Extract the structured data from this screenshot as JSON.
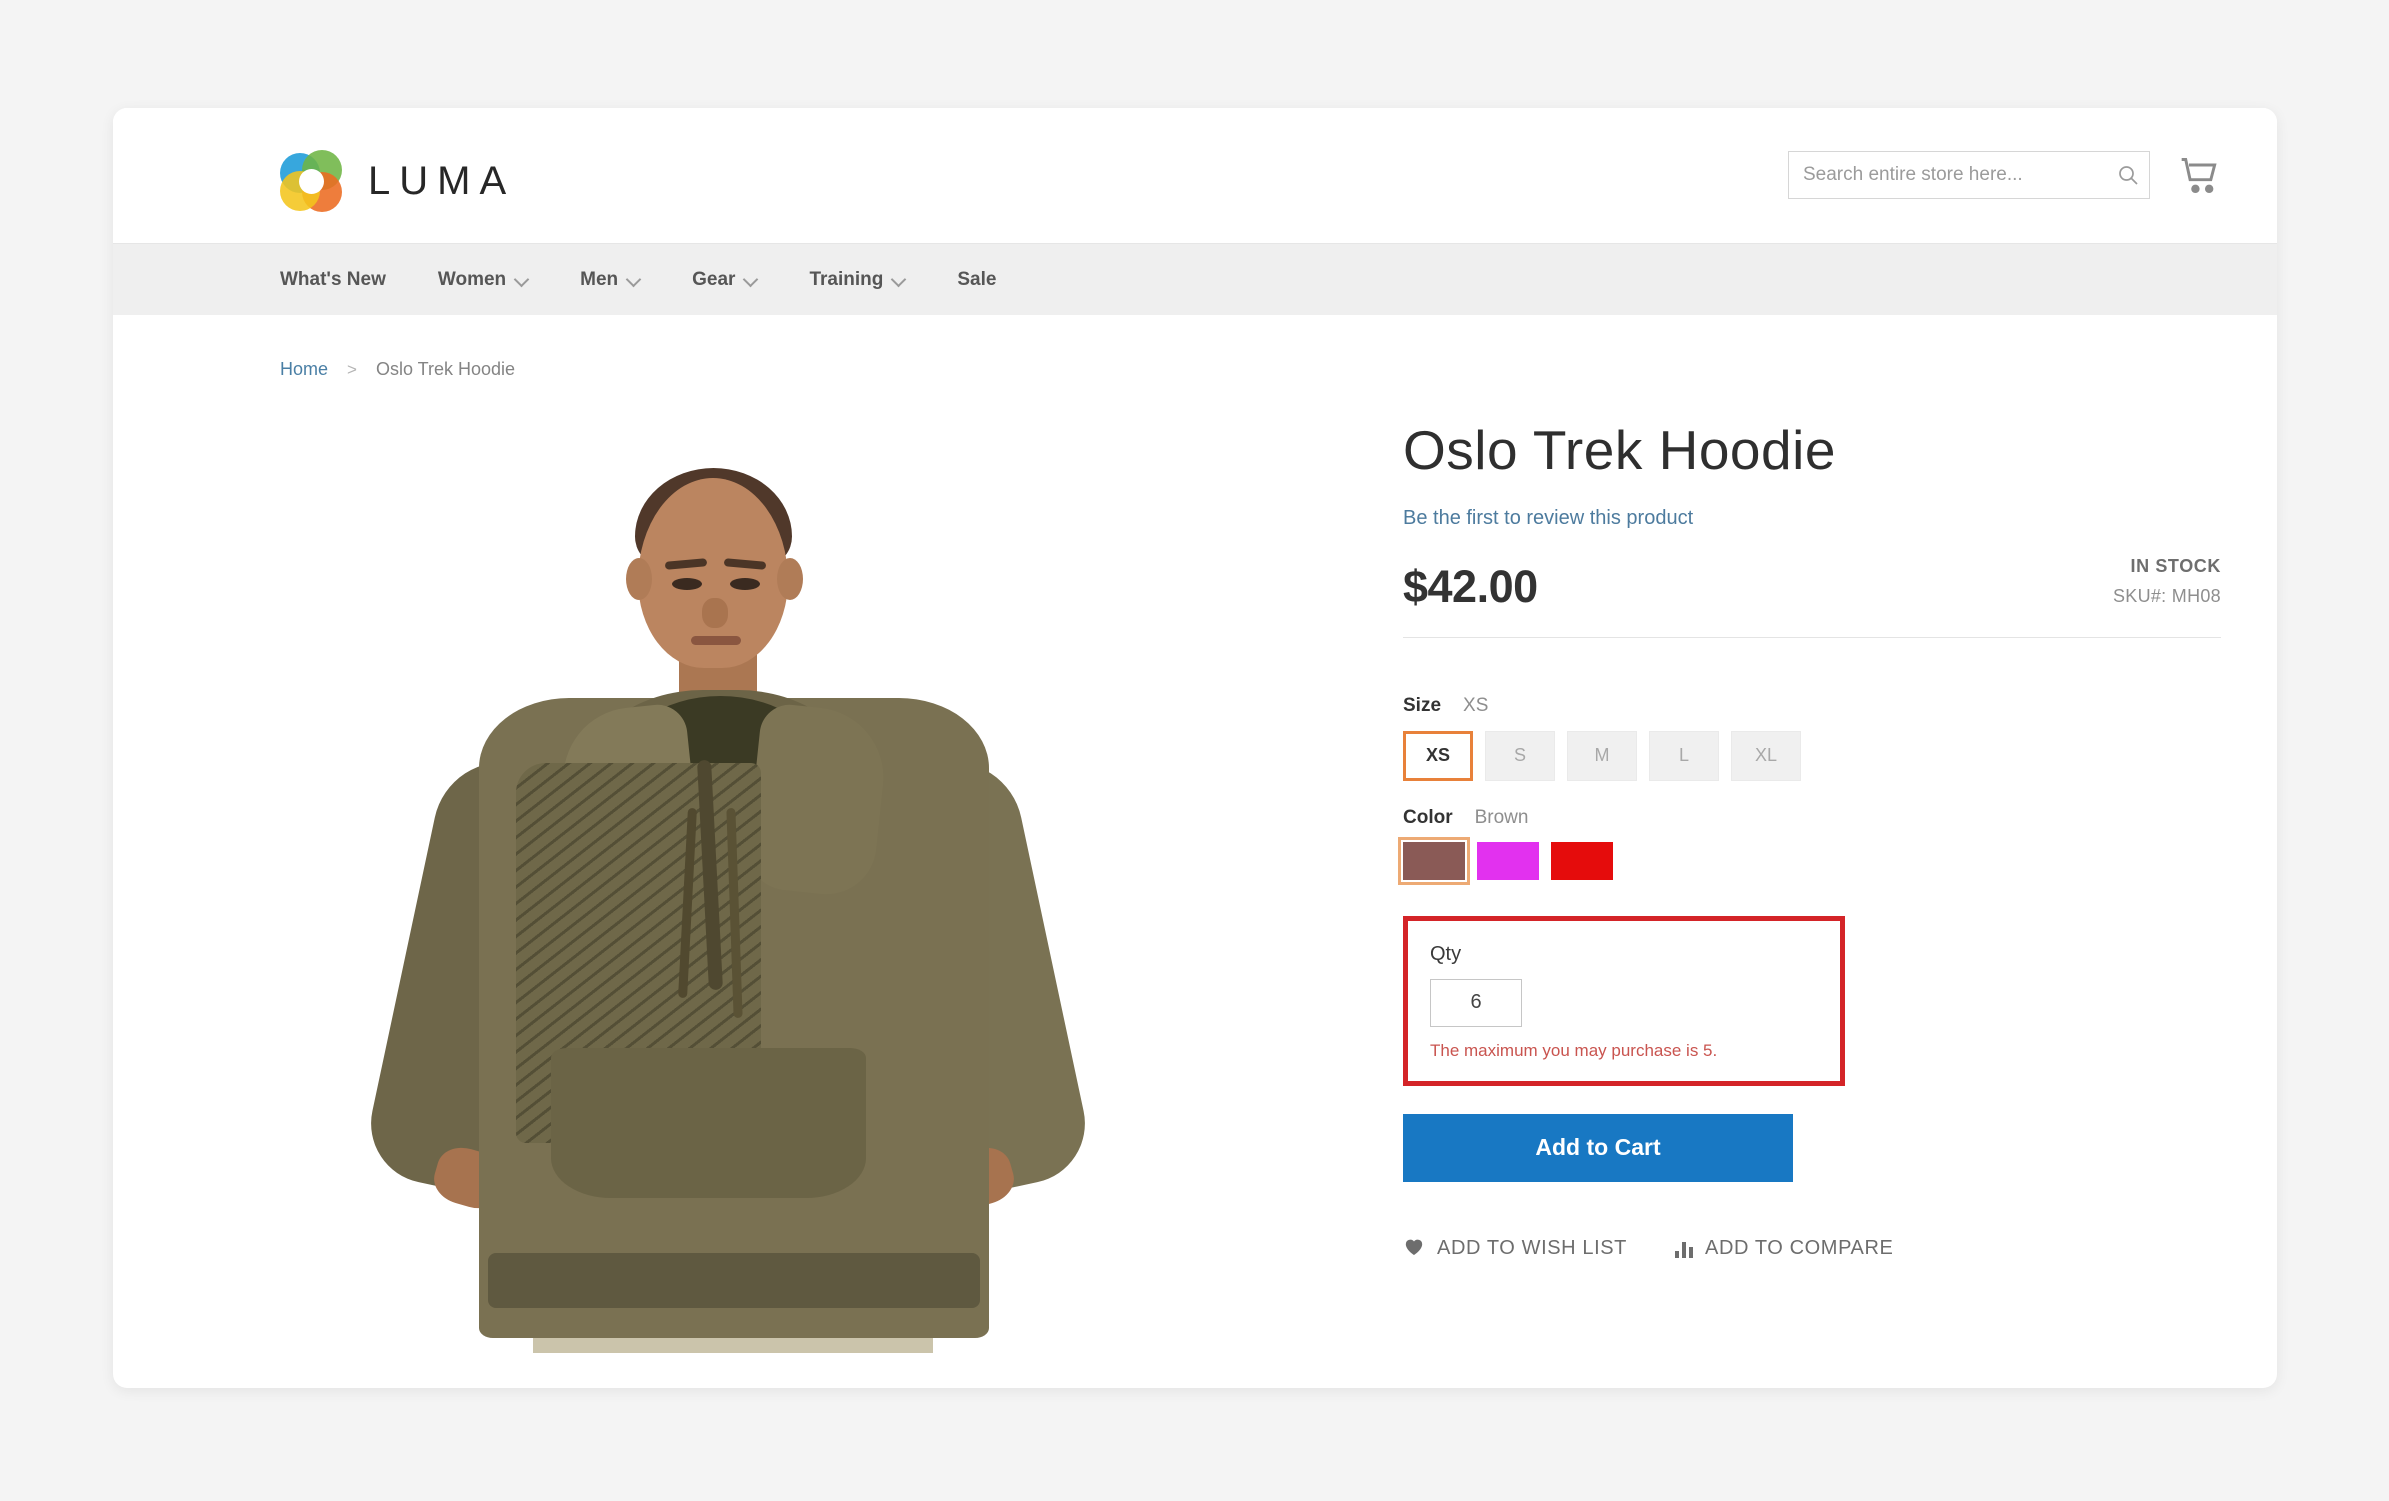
{
  "header": {
    "brand": "LUMA",
    "logo_icon": "luma-ring-logo",
    "search": {
      "placeholder": "Search entire store here...",
      "value": "",
      "icon": "search-icon"
    },
    "cart_icon": "shopping-cart-icon"
  },
  "nav": {
    "items": [
      {
        "label": "What's New",
        "has_dropdown": false
      },
      {
        "label": "Women",
        "has_dropdown": true
      },
      {
        "label": "Men",
        "has_dropdown": true
      },
      {
        "label": "Gear",
        "has_dropdown": true
      },
      {
        "label": "Training",
        "has_dropdown": true
      },
      {
        "label": "Sale",
        "has_dropdown": false
      }
    ]
  },
  "breadcrumb": {
    "home": "Home",
    "separator": ">",
    "current": "Oslo Trek Hoodie"
  },
  "product": {
    "title": "Oslo Trek Hoodie",
    "review_link": "Be the first to review this product",
    "price": "$42.00",
    "stock_status": "IN STOCK",
    "sku": "SKU#:  MH08",
    "size": {
      "label": "Size",
      "selected": "XS",
      "options": [
        {
          "label": "XS",
          "selected": true
        },
        {
          "label": "S",
          "selected": false
        },
        {
          "label": "M",
          "selected": false
        },
        {
          "label": "L",
          "selected": false
        },
        {
          "label": "XL",
          "selected": false
        }
      ]
    },
    "color": {
      "label": "Color",
      "selected": "Brown",
      "options": [
        {
          "name": "Brown",
          "hex": "#8a5a56",
          "selected": true
        },
        {
          "name": "Purple",
          "hex": "#e231ef",
          "selected": false
        },
        {
          "name": "Red",
          "hex": "#e50c0c",
          "selected": false
        }
      ]
    },
    "qty": {
      "label": "Qty",
      "value": "6",
      "error": "The maximum you may purchase is 5."
    },
    "add_to_cart": "Add to Cart",
    "wish_list": "ADD TO WISH LIST",
    "compare": "ADD TO COMPARE",
    "image_alt": "Male model wearing olive green Oslo Trek Hoodie"
  },
  "colors": {
    "accent_blue": "#1878c3",
    "selected_orange": "#e8813a",
    "error_red": "#d42428",
    "error_text": "#c9544f",
    "link_blue": "#4d7b9e",
    "page_background": "#f4f4f4",
    "nav_background": "#efefef"
  }
}
